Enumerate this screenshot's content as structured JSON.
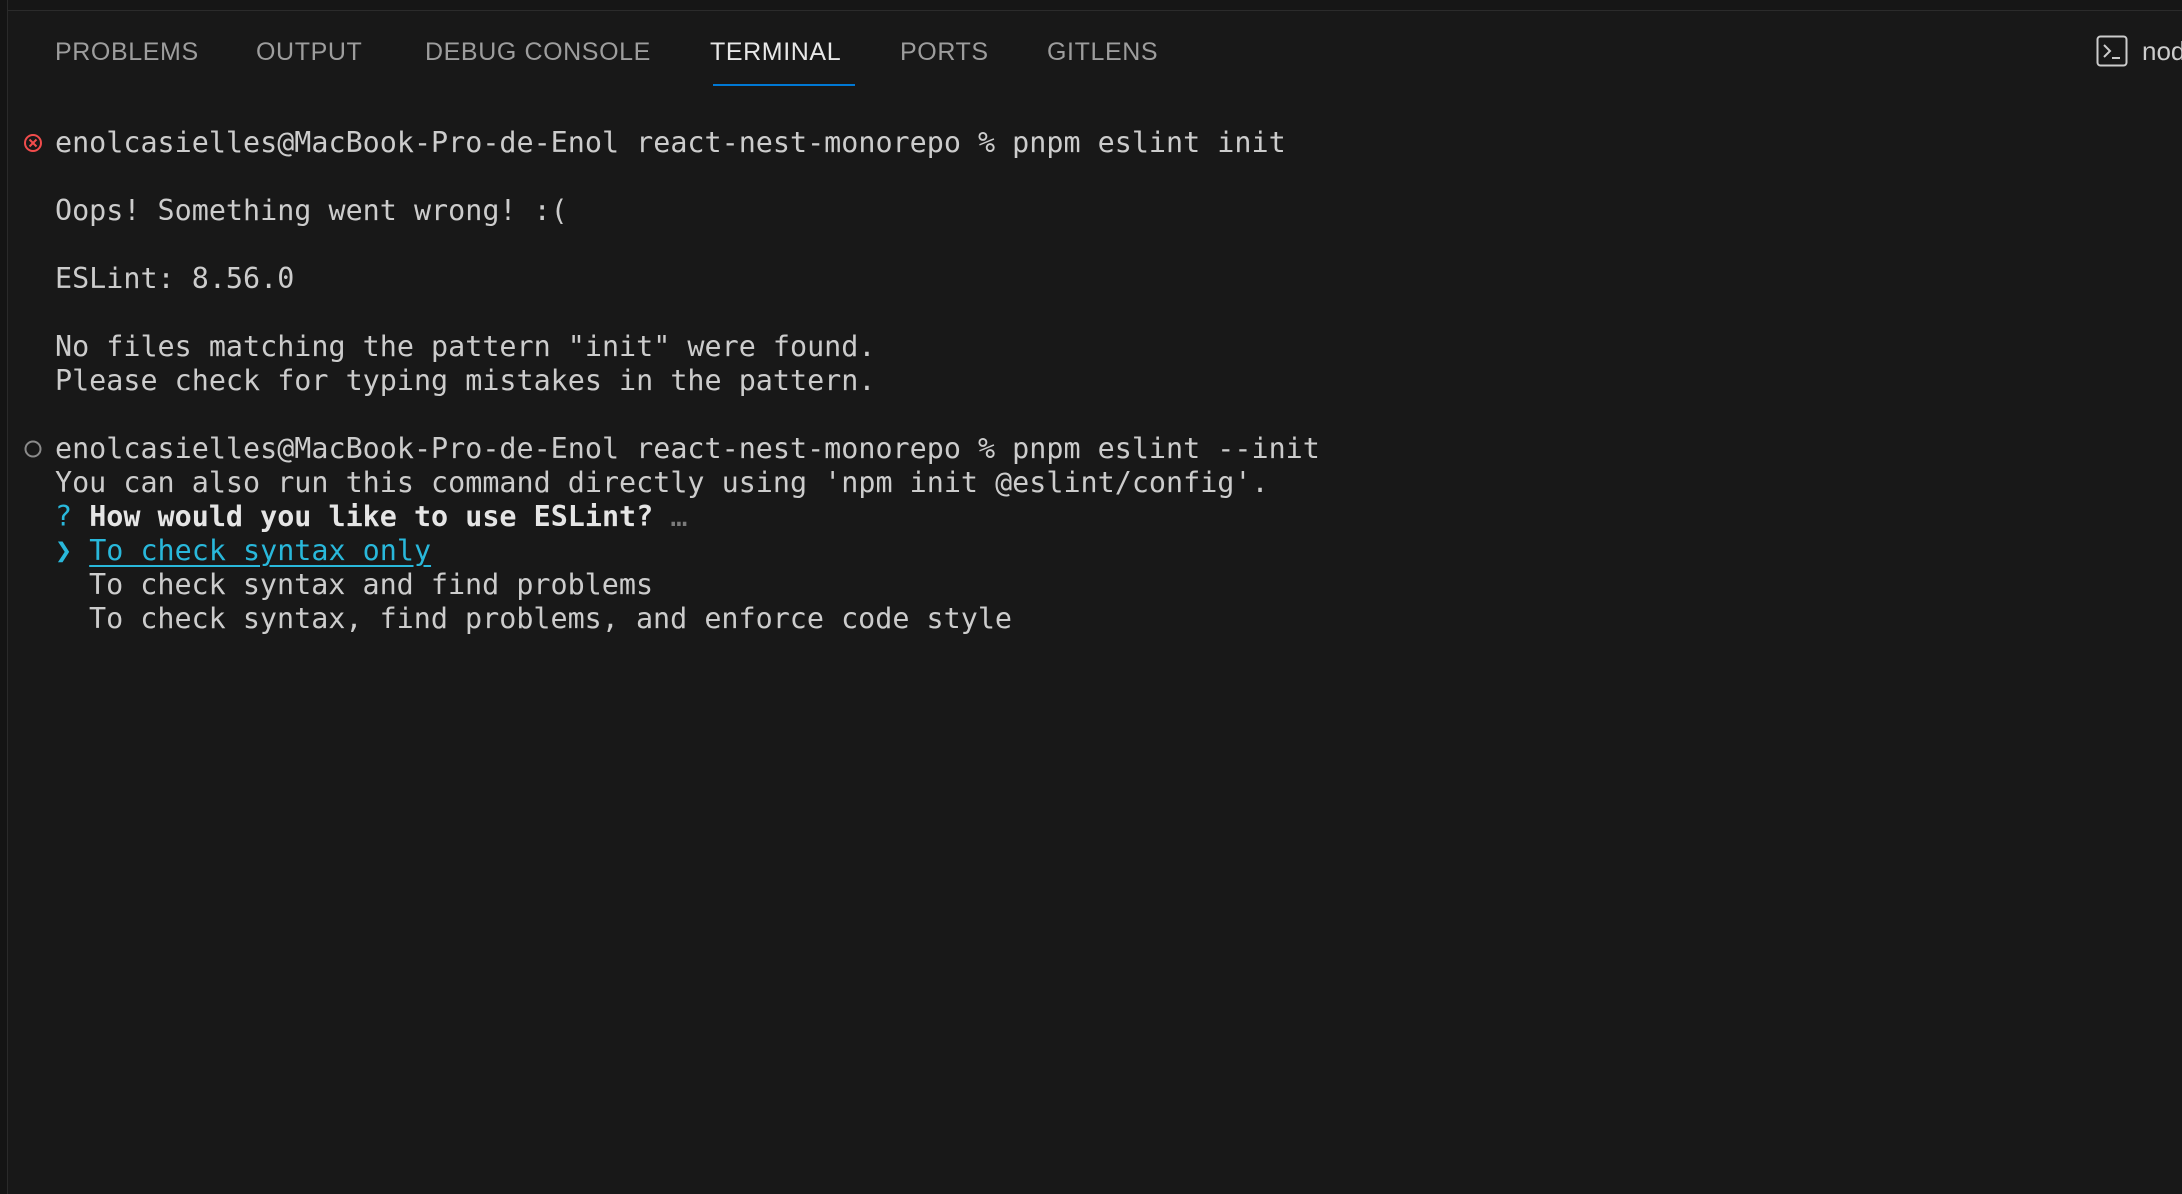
{
  "panel": {
    "tabs": [
      {
        "label": "PROBLEMS"
      },
      {
        "label": "OUTPUT"
      },
      {
        "label": "DEBUG CONSOLE"
      },
      {
        "label": "TERMINAL"
      },
      {
        "label": "PORTS"
      },
      {
        "label": "GITLENS"
      }
    ],
    "active_tab": "TERMINAL",
    "terminal_selector_label": "node",
    "accent_color": "#0078d4"
  },
  "terminal": {
    "prompt1": {
      "text": "enolcasielles@MacBook-Pro-de-Enol react-nest-monorepo % pnpm eslint init",
      "status": "error",
      "status_icon": "error-circle-icon"
    },
    "output1": [
      "Oops! Something went wrong! :(",
      "ESLint: 8.56.0",
      "No files matching the pattern \"init\" were found.",
      "Please check for typing mistakes in the pattern."
    ],
    "prompt2": {
      "text": "enolcasielles@MacBook-Pro-de-Enol react-nest-monorepo % pnpm eslint --init",
      "status": "running",
      "status_icon": "hollow-circle-icon"
    },
    "output2": "You can also run this command directly using 'npm init @eslint/config'.",
    "question": {
      "marker": "?",
      "text": "How would you like to use ESLint?",
      "ellipsis": "…"
    },
    "options": {
      "pointer": "❯",
      "selected": "To check syntax only",
      "others": [
        "To check syntax and find problems",
        "To check syntax, find problems, and enforce code style"
      ]
    },
    "colors": {
      "error": "#f14c4c",
      "cyan": "#29b8db",
      "text": "#cccccc"
    }
  }
}
